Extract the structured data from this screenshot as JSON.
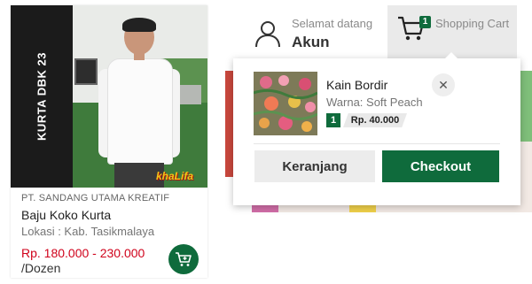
{
  "product_card": {
    "banner_text": "KURTA DBK 23",
    "photo_watermark": "khaLifa",
    "seller": "PT. SANDANG UTAMA KREATIF",
    "name": "Baju Koko Kurta",
    "location": "Lokasi : Kab. Tasikmalaya",
    "price": "Rp. 180.000 - 230.000",
    "unit": "/Dozen",
    "cart_button_icon": "cart-plus-icon"
  },
  "header": {
    "account": {
      "icon": "user-icon",
      "greeting": "Selamat datang",
      "name": "Akun"
    },
    "cart": {
      "icon": "shopping-cart-icon",
      "count": "1",
      "label": "Shopping Cart"
    }
  },
  "cart_dropdown": {
    "items": [
      {
        "title": "Kain Bordir",
        "variant": "Warna: Soft Peach",
        "quantity": "1",
        "price": "Rp. 40.000",
        "remove_icon": "close-icon"
      }
    ],
    "cart_button_label": "Keranjang",
    "checkout_button_label": "Checkout"
  },
  "colors": {
    "accent_green": "#0f6b3c",
    "price_red": "#d0021b"
  }
}
